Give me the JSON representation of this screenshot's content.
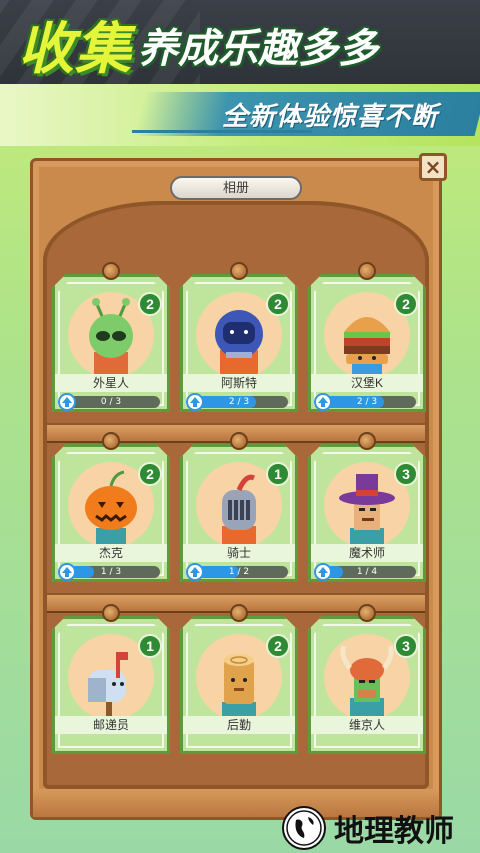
{
  "header": {
    "title_main": "收集",
    "title_sub": "养成乐趣多多",
    "slogan": "全新体验惊喜不断"
  },
  "album": {
    "title": "相册",
    "close_label": "×"
  },
  "cards": [
    {
      "name": "外星人",
      "level": "2",
      "progress_text": "0 / 3",
      "progress": 0.0,
      "icon": "alien-icon"
    },
    {
      "name": "阿斯特",
      "level": "2",
      "progress_text": "2 / 3",
      "progress": 0.67,
      "icon": "astronaut-icon"
    },
    {
      "name": "汉堡K",
      "level": "2",
      "progress_text": "2 / 3",
      "progress": 0.67,
      "icon": "burger-icon"
    },
    {
      "name": "杰克",
      "level": "2",
      "progress_text": "1 / 3",
      "progress": 0.33,
      "icon": "pumpkin-icon"
    },
    {
      "name": "骑士",
      "level": "1",
      "progress_text": "1 / 2",
      "progress": 0.5,
      "icon": "knight-icon"
    },
    {
      "name": "魔术师",
      "level": "3",
      "progress_text": "1 / 4",
      "progress": 0.25,
      "icon": "magician-icon"
    },
    {
      "name": "邮递员",
      "level": "1",
      "progress_text": "",
      "progress": 0.0,
      "icon": "mailbox-icon"
    },
    {
      "name": "后勤",
      "level": "2",
      "progress_text": "",
      "progress": 0.0,
      "icon": "log-icon"
    },
    {
      "name": "维京人",
      "level": "3",
      "progress_text": "",
      "progress": 0.0,
      "icon": "viking-icon"
    }
  ],
  "watermark": {
    "text": "地理教师"
  },
  "colors": {
    "progress_fill": "#2d97e6",
    "level_badge": "#2f8a34",
    "card_border": "#5e9a3a",
    "board_wood": "#c98a4c"
  }
}
